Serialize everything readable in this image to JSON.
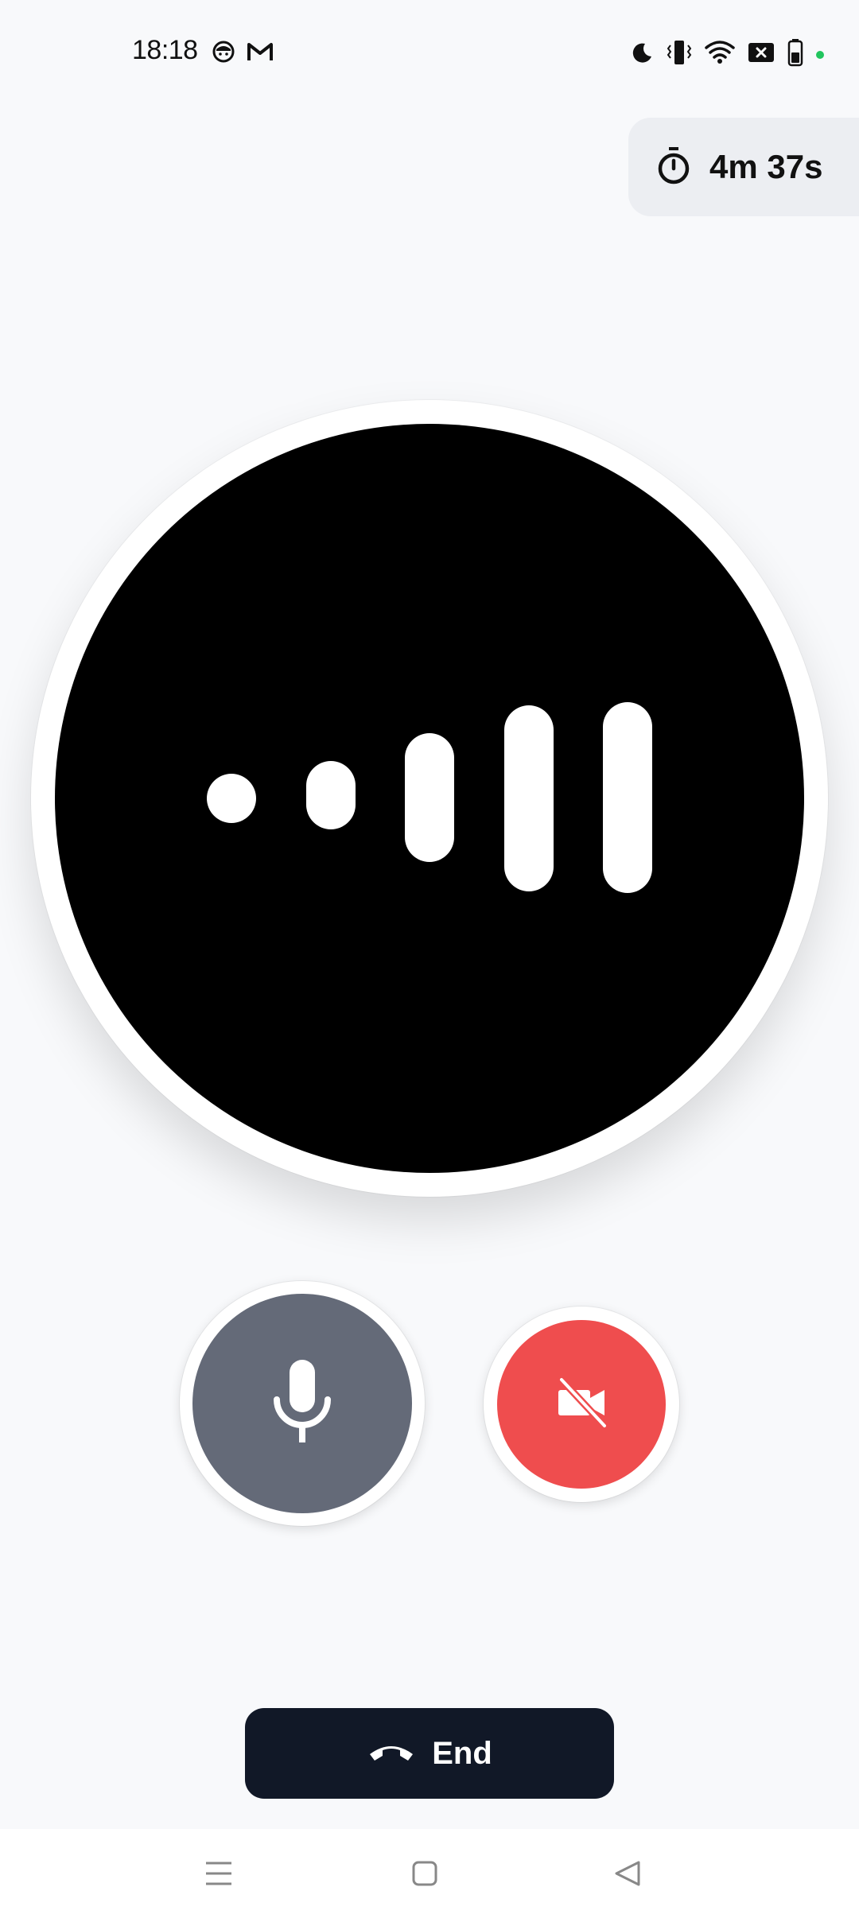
{
  "status_bar": {
    "time": "18:18",
    "left_icons": [
      "face-icon",
      "gmail-icon"
    ],
    "right_icons": [
      "moon-icon",
      "vibrate-icon",
      "wifi-icon",
      "data-off-icon",
      "battery-icon"
    ],
    "indicator_color": "#22c55e"
  },
  "timer": {
    "icon": "stopwatch-icon",
    "elapsed": "4m 37s"
  },
  "voice_visualizer": {
    "icon": "voice-level-icon",
    "bar_count": 5,
    "levels": [
      0.18,
      0.28,
      0.52,
      0.74,
      0.78
    ]
  },
  "controls": {
    "mic": {
      "icon": "microphone-icon",
      "state": "on",
      "color": "#646a78"
    },
    "camera": {
      "icon": "video-off-icon",
      "state": "off",
      "color": "#ef4d4e"
    }
  },
  "end_call": {
    "icon": "hang-up-icon",
    "label": "End",
    "color": "#111827"
  },
  "nav_bar": {
    "items": [
      "menu-icon",
      "home-icon",
      "back-icon"
    ]
  }
}
